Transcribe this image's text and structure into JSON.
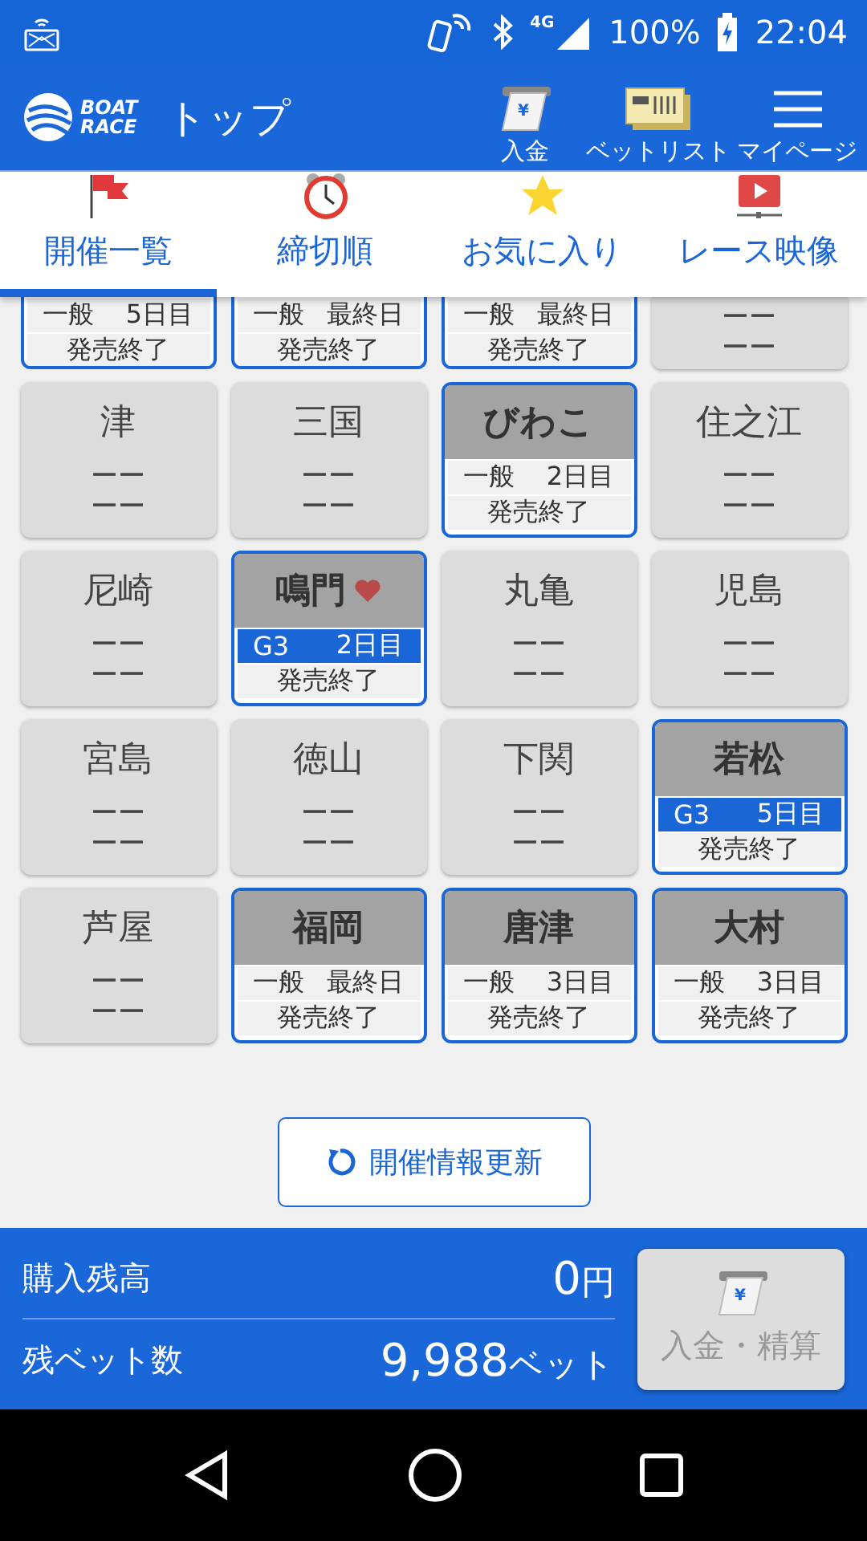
{
  "status_bar": {
    "network": "4G",
    "battery": "100%",
    "time": "22:04"
  },
  "header": {
    "logo": [
      "BOAT",
      "RACE"
    ],
    "title": "トップ",
    "actions": [
      {
        "label": "入金",
        "kind": "deposit",
        "icon_text": "¥"
      },
      {
        "label": "ベットリスト",
        "kind": "betlist"
      },
      {
        "label": "マイページ",
        "kind": "menu"
      }
    ]
  },
  "tabs": [
    {
      "label": "開催一覧",
      "kind": "flag",
      "selected": true
    },
    {
      "label": "締切順",
      "kind": "clock",
      "selected": false
    },
    {
      "label": "お気に入り",
      "kind": "star",
      "selected": false
    },
    {
      "label": "レース映像",
      "kind": "video",
      "selected": false
    }
  ],
  "venues": [
    {
      "kind": "open",
      "partial": true,
      "grade": "一般",
      "day": "5日目",
      "sales": "発売終了",
      "featured": false
    },
    {
      "kind": "open",
      "partial": true,
      "grade": "一般",
      "day": "最終日",
      "sales": "発売終了",
      "featured": false
    },
    {
      "kind": "open",
      "partial": true,
      "grade": "一般",
      "day": "最終日",
      "sales": "発売終了",
      "featured": false
    },
    {
      "kind": "closed",
      "partial": true,
      "lines": [
        "ーー",
        "ーー"
      ]
    },
    {
      "kind": "closed",
      "partial": false,
      "name": "津",
      "lines": [
        "ーー",
        "ーー"
      ]
    },
    {
      "kind": "closed",
      "partial": false,
      "name": "三国",
      "lines": [
        "ーー",
        "ーー"
      ]
    },
    {
      "kind": "open",
      "partial": false,
      "name": "びわこ",
      "grade": "一般",
      "day": "2日目",
      "sales": "発売終了",
      "featured": false,
      "favorite": false
    },
    {
      "kind": "closed",
      "partial": false,
      "name": "住之江",
      "lines": [
        "ーー",
        "ーー"
      ]
    },
    {
      "kind": "closed",
      "partial": false,
      "name": "尼崎",
      "lines": [
        "ーー",
        "ーー"
      ]
    },
    {
      "kind": "open",
      "partial": false,
      "name": "鳴門",
      "grade": "G3",
      "day": "2日目",
      "sales": "発売終了",
      "featured": true,
      "favorite": true
    },
    {
      "kind": "closed",
      "partial": false,
      "name": "丸亀",
      "lines": [
        "ーー",
        "ーー"
      ]
    },
    {
      "kind": "closed",
      "partial": false,
      "name": "児島",
      "lines": [
        "ーー",
        "ーー"
      ]
    },
    {
      "kind": "closed",
      "partial": false,
      "name": "宮島",
      "lines": [
        "ーー",
        "ーー"
      ]
    },
    {
      "kind": "closed",
      "partial": false,
      "name": "徳山",
      "lines": [
        "ーー",
        "ーー"
      ]
    },
    {
      "kind": "closed",
      "partial": false,
      "name": "下関",
      "lines": [
        "ーー",
        "ーー"
      ]
    },
    {
      "kind": "open",
      "partial": false,
      "name": "若松",
      "grade": "G3",
      "day": "5日目",
      "sales": "発売終了",
      "featured": true,
      "favorite": false
    },
    {
      "kind": "closed",
      "partial": false,
      "name": "芦屋",
      "lines": [
        "ーー",
        "ーー"
      ]
    },
    {
      "kind": "open",
      "partial": false,
      "name": "福岡",
      "grade": "一般",
      "day": "最終日",
      "sales": "発売終了",
      "featured": false,
      "favorite": false
    },
    {
      "kind": "open",
      "partial": false,
      "name": "唐津",
      "grade": "一般",
      "day": "3日目",
      "sales": "発売終了",
      "featured": false,
      "favorite": false
    },
    {
      "kind": "open",
      "partial": false,
      "name": "大村",
      "grade": "一般",
      "day": "3日目",
      "sales": "発売終了",
      "featured": false,
      "favorite": false
    }
  ],
  "refresh_button": "開催情報更新",
  "balance": {
    "rows": [
      {
        "label": "購入残高",
        "value": "0",
        "unit": "円"
      },
      {
        "label": "残ベット数",
        "value": "9,988",
        "unit": "ベット"
      }
    ],
    "button": {
      "label": "入金・精算",
      "icon_text": "¥",
      "disabled": true
    }
  }
}
